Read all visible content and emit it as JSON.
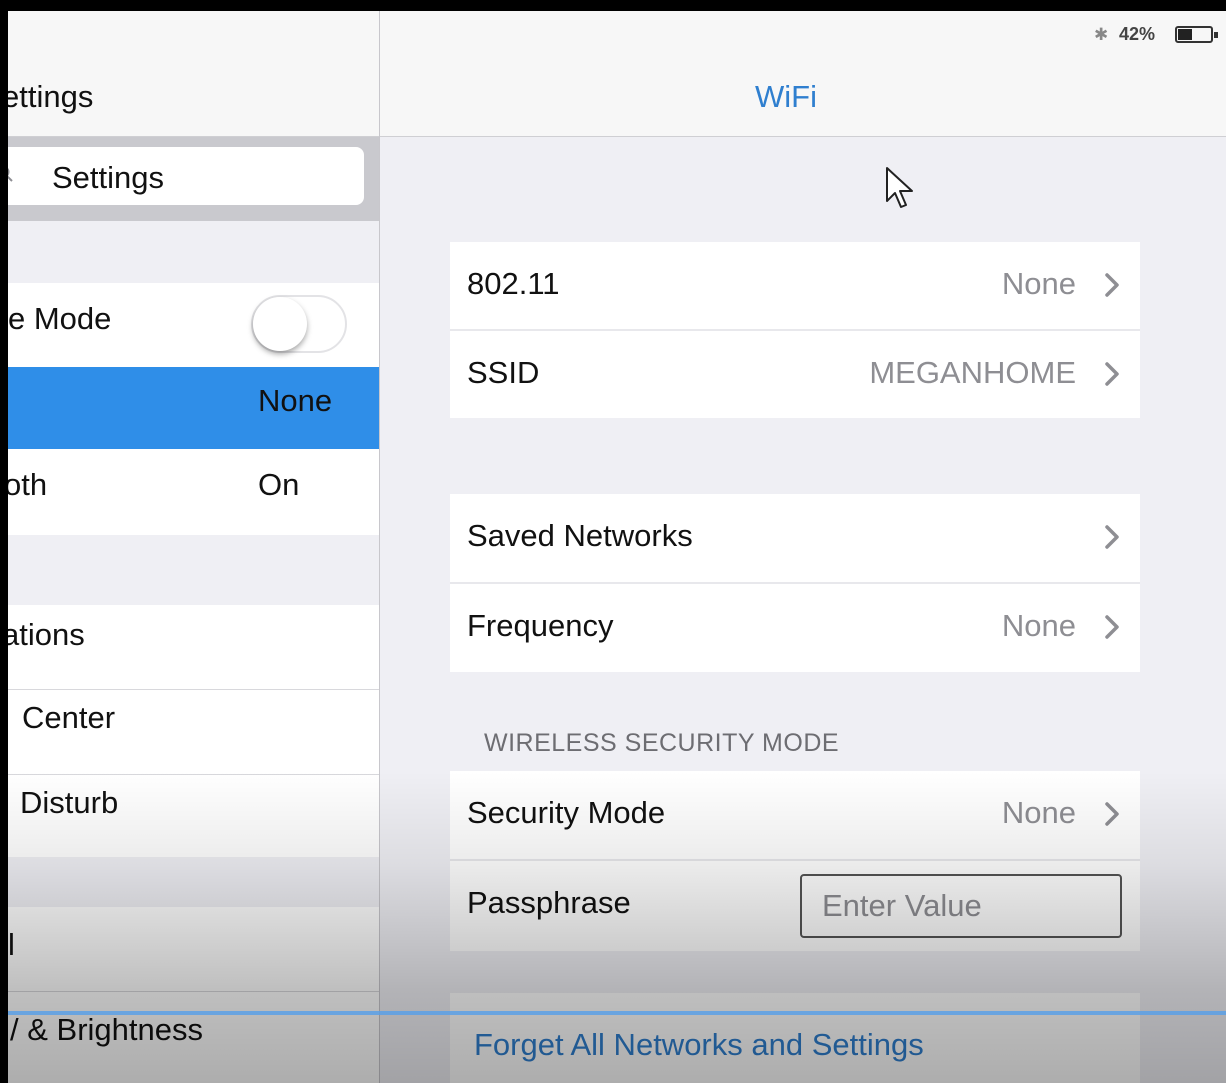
{
  "sidebar": {
    "title": "ettings",
    "search_text": "Settings",
    "rows": {
      "airplane_label": "e Mode",
      "wifi_value": "None",
      "bluetooth_label": "oth",
      "bluetooth_value": "On",
      "notifications_label": "ations",
      "control_center_label": "Center",
      "dnd_label": "Disturb",
      "general_label": "l",
      "display_label": "& Brightness"
    },
    "selected_color": "#2f8ee8"
  },
  "status_bar": {
    "battery_percent": "42%",
    "bluetooth_glyph": "✱"
  },
  "detail": {
    "title": "WiFi",
    "rows": [
      {
        "label": "802.11",
        "value": "None"
      },
      {
        "label": "SSID",
        "value": "MEGANHOME"
      },
      {
        "label": "Saved Networks",
        "value": ""
      },
      {
        "label": "Frequency",
        "value": "None"
      }
    ],
    "security_section_header": "WIRELESS SECURITY MODE",
    "security_mode": {
      "label": "Security Mode",
      "value": "None"
    },
    "passphrase": {
      "label": "Passphrase",
      "placeholder": "Enter Value",
      "value": ""
    },
    "forget_label": "Forget All Networks and Settings",
    "accent_color": "#2f7fcf"
  }
}
